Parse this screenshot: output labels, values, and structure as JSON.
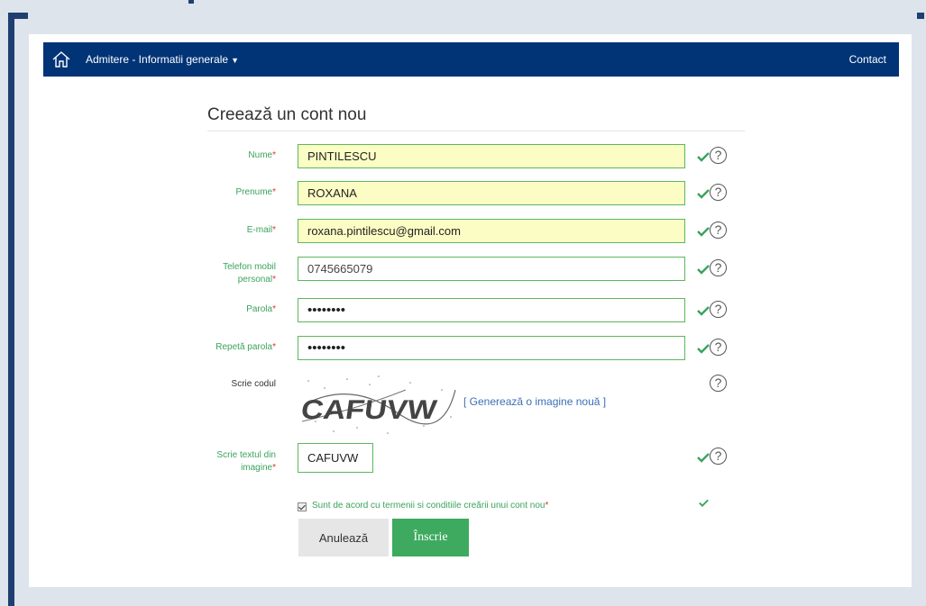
{
  "nav": {
    "admitere_label": "Admitere - Informatii generale",
    "contact_label": "Contact",
    "bg_color": "#003476"
  },
  "form": {
    "title": "Creează un cont nou",
    "fields": {
      "nume": {
        "label": "Nume",
        "value": "PINTILESCU"
      },
      "prenume": {
        "label": "Prenume",
        "value": "ROXANA"
      },
      "email": {
        "label": "E-mail",
        "value": "roxana.pintilescu@gmail.com"
      },
      "telefon": {
        "label_line1": "Telefon mobil",
        "label_line2": "personal",
        "value": "0745665079"
      },
      "parola": {
        "label": "Parola",
        "value": "••••••••"
      },
      "repeta_parola": {
        "label": "Repetă parola",
        "value": "••••••••"
      },
      "cod": {
        "label": "Scrie codul",
        "captcha_text": "CAFUVW",
        "regen_link": "[ Generează o imagine nouă ]"
      },
      "text_imagine": {
        "label_line1": "Scrie textul din",
        "label_line2": "imagine",
        "value": "CAFUVW"
      }
    },
    "required_mark": "*",
    "help_glyph": "?",
    "terms_label": "Sunt de acord cu termenii si conditiile creării unui cont nou",
    "cancel_label": "Anulează",
    "submit_label": "Înscrie"
  },
  "colors": {
    "valid_green": "#3aa35d",
    "required_red": "#d9342b",
    "filled_bg": "#fcfdc4",
    "submit_bg": "#3eaa5f"
  }
}
